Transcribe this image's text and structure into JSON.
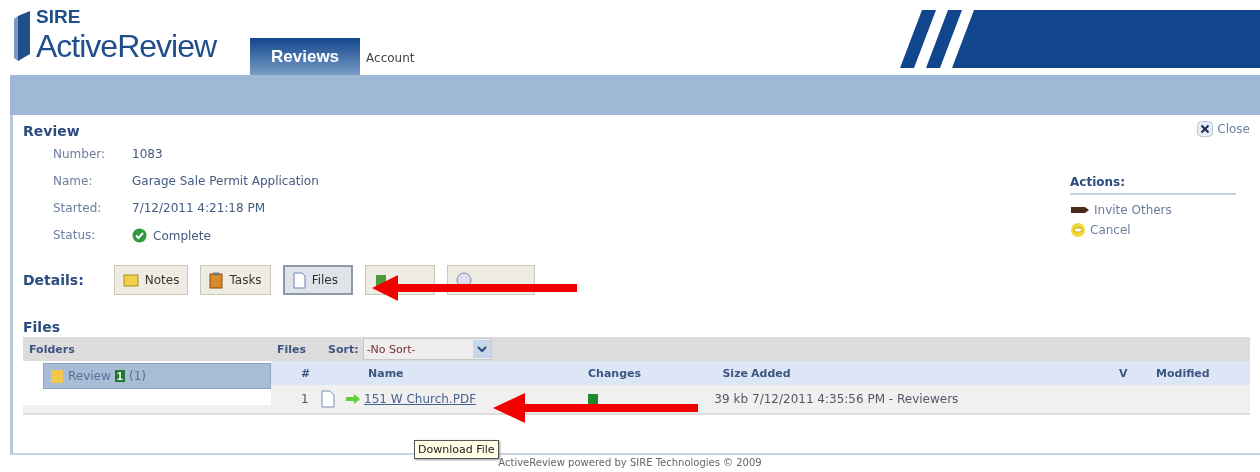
{
  "app": {
    "brand_small": "SIRE",
    "brand_large": "ActiveReview"
  },
  "tabs": [
    {
      "label": "Reviews",
      "selected": true
    },
    {
      "label": "Account",
      "selected": false
    }
  ],
  "review": {
    "title": "Review",
    "close": "Close",
    "fields": [
      {
        "label": "Number:",
        "value": "1083",
        "kind": "text"
      },
      {
        "label": "Name:",
        "value": "Garage Sale Permit Application",
        "kind": "text"
      },
      {
        "label": "Started:",
        "value": "7/12/2011 4:21:18 PM",
        "kind": "text"
      },
      {
        "label": "Status:",
        "value": "Complete",
        "kind": "status"
      }
    ],
    "actions": {
      "title": "Actions:",
      "items": [
        {
          "label": "Invite Others",
          "kind": "invite"
        },
        {
          "label": "Cancel",
          "kind": "cancel"
        }
      ]
    },
    "details": {
      "label": "Details:",
      "buttons": [
        {
          "label": "Notes",
          "kind": "notes",
          "selected": false
        },
        {
          "label": "Tasks",
          "kind": "tasks",
          "selected": false
        },
        {
          "label": "Files",
          "kind": "files",
          "selected": true
        },
        {
          "kind": "fees",
          "selected": false
        },
        {
          "kind": "history",
          "selected": false
        }
      ]
    }
  },
  "files": {
    "title": "Files",
    "folders_header": "Folders",
    "folders": [
      {
        "name": "Review",
        "badge": "1",
        "count": "(1)",
        "selected": true
      }
    ],
    "files_header": "Files",
    "sort_label": "Sort:",
    "sort_value": "-No Sort-",
    "columns": [
      "#",
      "Name",
      "Changes",
      "Size",
      "Added",
      "V",
      "Modified"
    ],
    "rows": [
      {
        "number": "1",
        "name": "151 W Church.PDF",
        "size": "39 kb",
        "added": "7/12/2011 4:35:56 PM - Reviewers"
      }
    ],
    "tooltip": "Download File"
  },
  "footer": "ActiveReview powered by SIRE Technologies © 2009"
}
